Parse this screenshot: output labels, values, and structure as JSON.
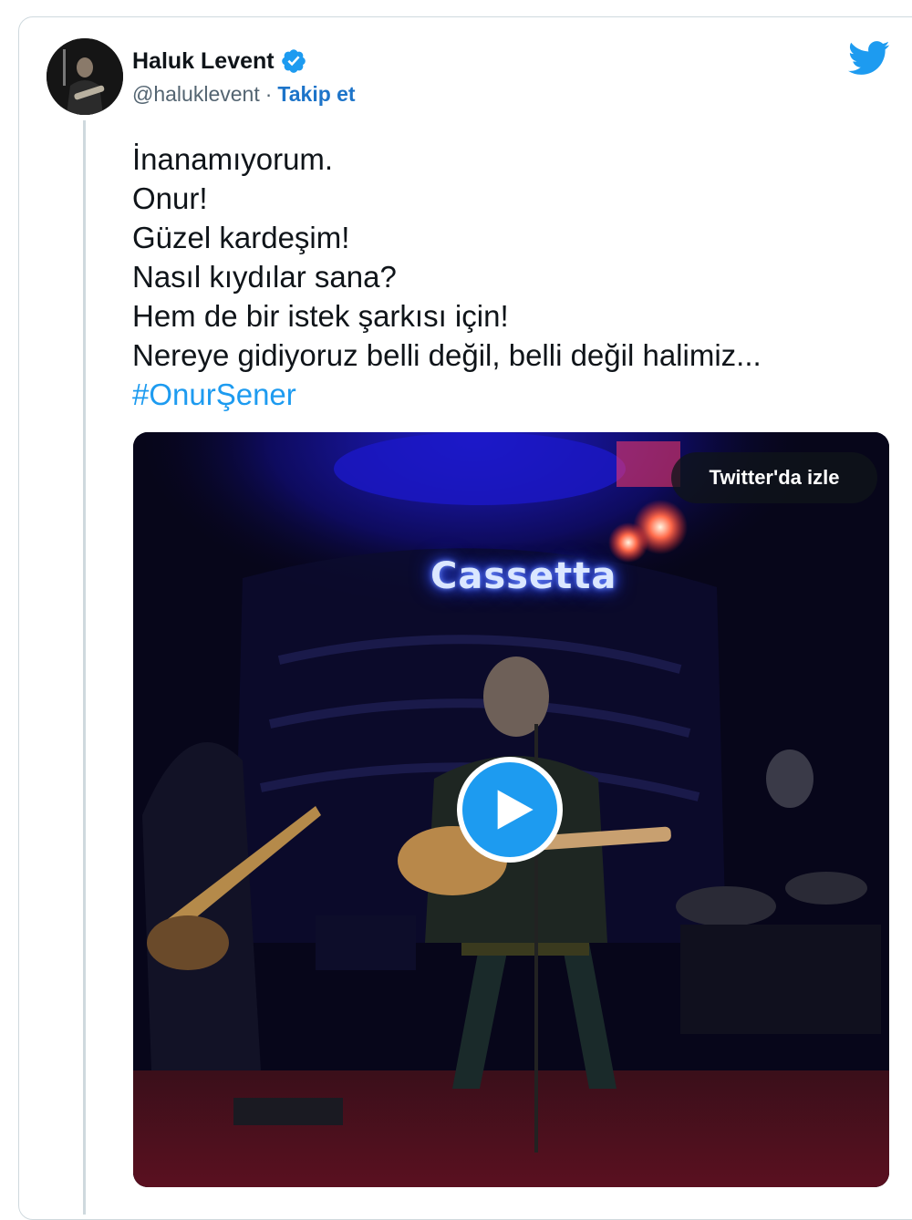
{
  "author": {
    "display_name": "Haluk Levent",
    "handle": "@haluklevent",
    "separator": "·",
    "follow_label": "Takip et",
    "verified": true
  },
  "icons": {
    "avatar": "avatar-image",
    "verified": "verified-badge-icon",
    "brand": "twitter-bird-icon",
    "play": "play-icon"
  },
  "tweet": {
    "lines": [
      "İnanamıyorum.",
      "Onur!",
      "Güzel kardeşim!",
      "Nasıl kıydılar sana?",
      "Hem de bir istek şarkısı için!",
      "Nereye gidiyoruz belli değil, belli değil halimiz..."
    ],
    "hashtag": "#OnurŞener"
  },
  "media": {
    "watch_label": "Twitter'da izle",
    "sign_text": "Cassetta"
  },
  "colors": {
    "accent": "#1d9bf0",
    "follow": "#1d74c9",
    "text": "#0f1419",
    "muted": "#536471",
    "border": "#cfd9de"
  }
}
